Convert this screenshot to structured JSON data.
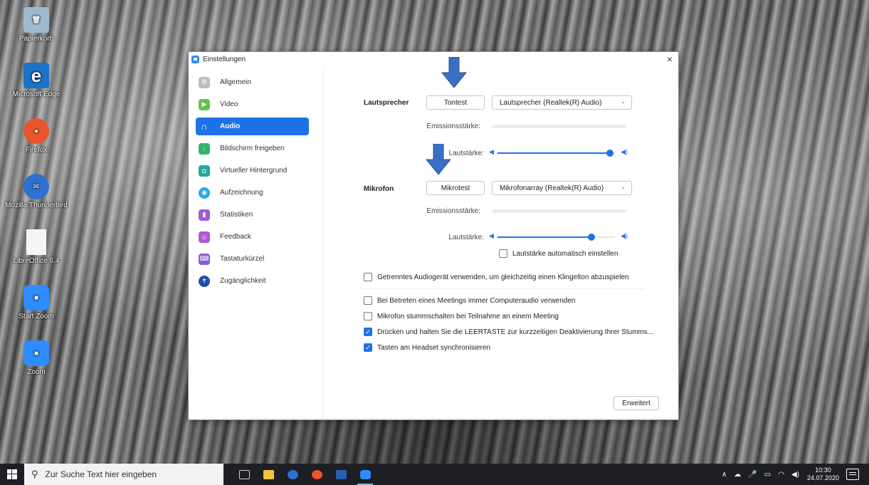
{
  "desktop": {
    "icons": [
      {
        "label": "Papierkorb",
        "icon": "recycle-bin-icon",
        "color": "#9fb9cf",
        "glyph": "🗑"
      },
      {
        "label": "Microsoft Edge",
        "icon": "edge-icon",
        "color": "#1a73c9",
        "glyph": "e"
      },
      {
        "label": "Firefox",
        "icon": "firefox-icon",
        "color": "#e8542b",
        "glyph": "●"
      },
      {
        "label": "Mozilla Thunderbird",
        "icon": "thunderbird-icon",
        "color": "#2f6fcf",
        "glyph": "✉"
      },
      {
        "label": "LibreOffice 6.4",
        "icon": "libreoffice-icon",
        "color": "#f5f5f5",
        "glyph": ""
      },
      {
        "label": "Start Zoom",
        "icon": "zoom-icon",
        "color": "#2d8cff",
        "glyph": "■"
      },
      {
        "label": "Zoom",
        "icon": "zoom-icon",
        "color": "#2d8cff",
        "glyph": "■"
      }
    ]
  },
  "dialog": {
    "title": "Einstellungen",
    "close_glyph": "×"
  },
  "sidebar": {
    "items": [
      {
        "label": "Allgemein",
        "icon": "gear-icon",
        "color": "#bdbdbd",
        "glyph": "⚙"
      },
      {
        "label": "Video",
        "icon": "video-icon",
        "color": "#62c34b",
        "glyph": "▶"
      },
      {
        "label": "Audio",
        "icon": "headphones-icon",
        "color": "#1e72e8",
        "glyph": "∩"
      },
      {
        "label": "Bildschirm freigeben",
        "icon": "share-screen-icon",
        "color": "#35b06b",
        "glyph": "↑"
      },
      {
        "label": "Virtueller Hintergrund",
        "icon": "person-icon",
        "color": "#1fa9a0",
        "glyph": "◘"
      },
      {
        "label": "Aufzeichnung",
        "icon": "record-icon",
        "color": "#2aa7e8",
        "glyph": "◉"
      },
      {
        "label": "Statistiken",
        "icon": "stats-icon",
        "color": "#a25ad9",
        "glyph": "▮"
      },
      {
        "label": "Feedback",
        "icon": "feedback-icon",
        "color": "#b157d6",
        "glyph": "☺"
      },
      {
        "label": "Tastaturkürzel",
        "icon": "keyboard-icon",
        "color": "#8b5ad9",
        "glyph": "⌨"
      },
      {
        "label": "Zugänglichkeit",
        "icon": "accessibility-icon",
        "color": "#1e4fa8",
        "glyph": "✝"
      }
    ],
    "active_index": 2
  },
  "speaker": {
    "label": "Lautsprecher",
    "test_button": "Tontest",
    "device": "Lautsprecher (Realtek(R) Audio)",
    "emission_label": "Emissionsstärke:",
    "volume_label": "Lautstärke:",
    "volume": 0.96
  },
  "mic": {
    "label": "Mikrofon",
    "test_button": "Mikrotest",
    "device": "Mikrofonarray (Realtek(R) Audio)",
    "emission_label": "Emissionsstärke:",
    "volume_label": "Lautstärke:",
    "volume": 0.8,
    "auto_adjust_label": "Lautstärke automatisch einstellen",
    "auto_adjust": false
  },
  "options": [
    {
      "label": "Getrenntes Audiogerät verwenden, um gleichzeitig einen Klingelton abzuspielen",
      "checked": false
    },
    {
      "label": "Bei Betreten eines Meetings immer Computeraudio verwenden",
      "checked": false
    },
    {
      "label": "Mikrofon stummschalten bei Teilnahme an einem Meeting",
      "checked": false
    },
    {
      "label": "Drücken und halten Sie die LEERTASTE zur kurzzeitigen Deaktivierung Ihrer Stumms...",
      "checked": true
    },
    {
      "label": "Tasten am Headset synchronisieren",
      "checked": true
    }
  ],
  "advanced_button": "Erweitert",
  "annotation_color": "#3b6fc4",
  "taskbar": {
    "search_placeholder": "Zur Suche Text hier eingeben",
    "time": "10:30",
    "date": "24.07.2020",
    "apps": [
      {
        "icon": "task-view-icon",
        "color": "#cfcfcf"
      },
      {
        "icon": "file-explorer-icon",
        "color": "#f3c33b"
      },
      {
        "icon": "thunderbird-icon",
        "color": "#2f6fcf"
      },
      {
        "icon": "firefox-icon",
        "color": "#e8542b"
      },
      {
        "icon": "word-icon",
        "color": "#2b5fb4"
      },
      {
        "icon": "zoom-icon",
        "color": "#2d8cff"
      }
    ]
  }
}
